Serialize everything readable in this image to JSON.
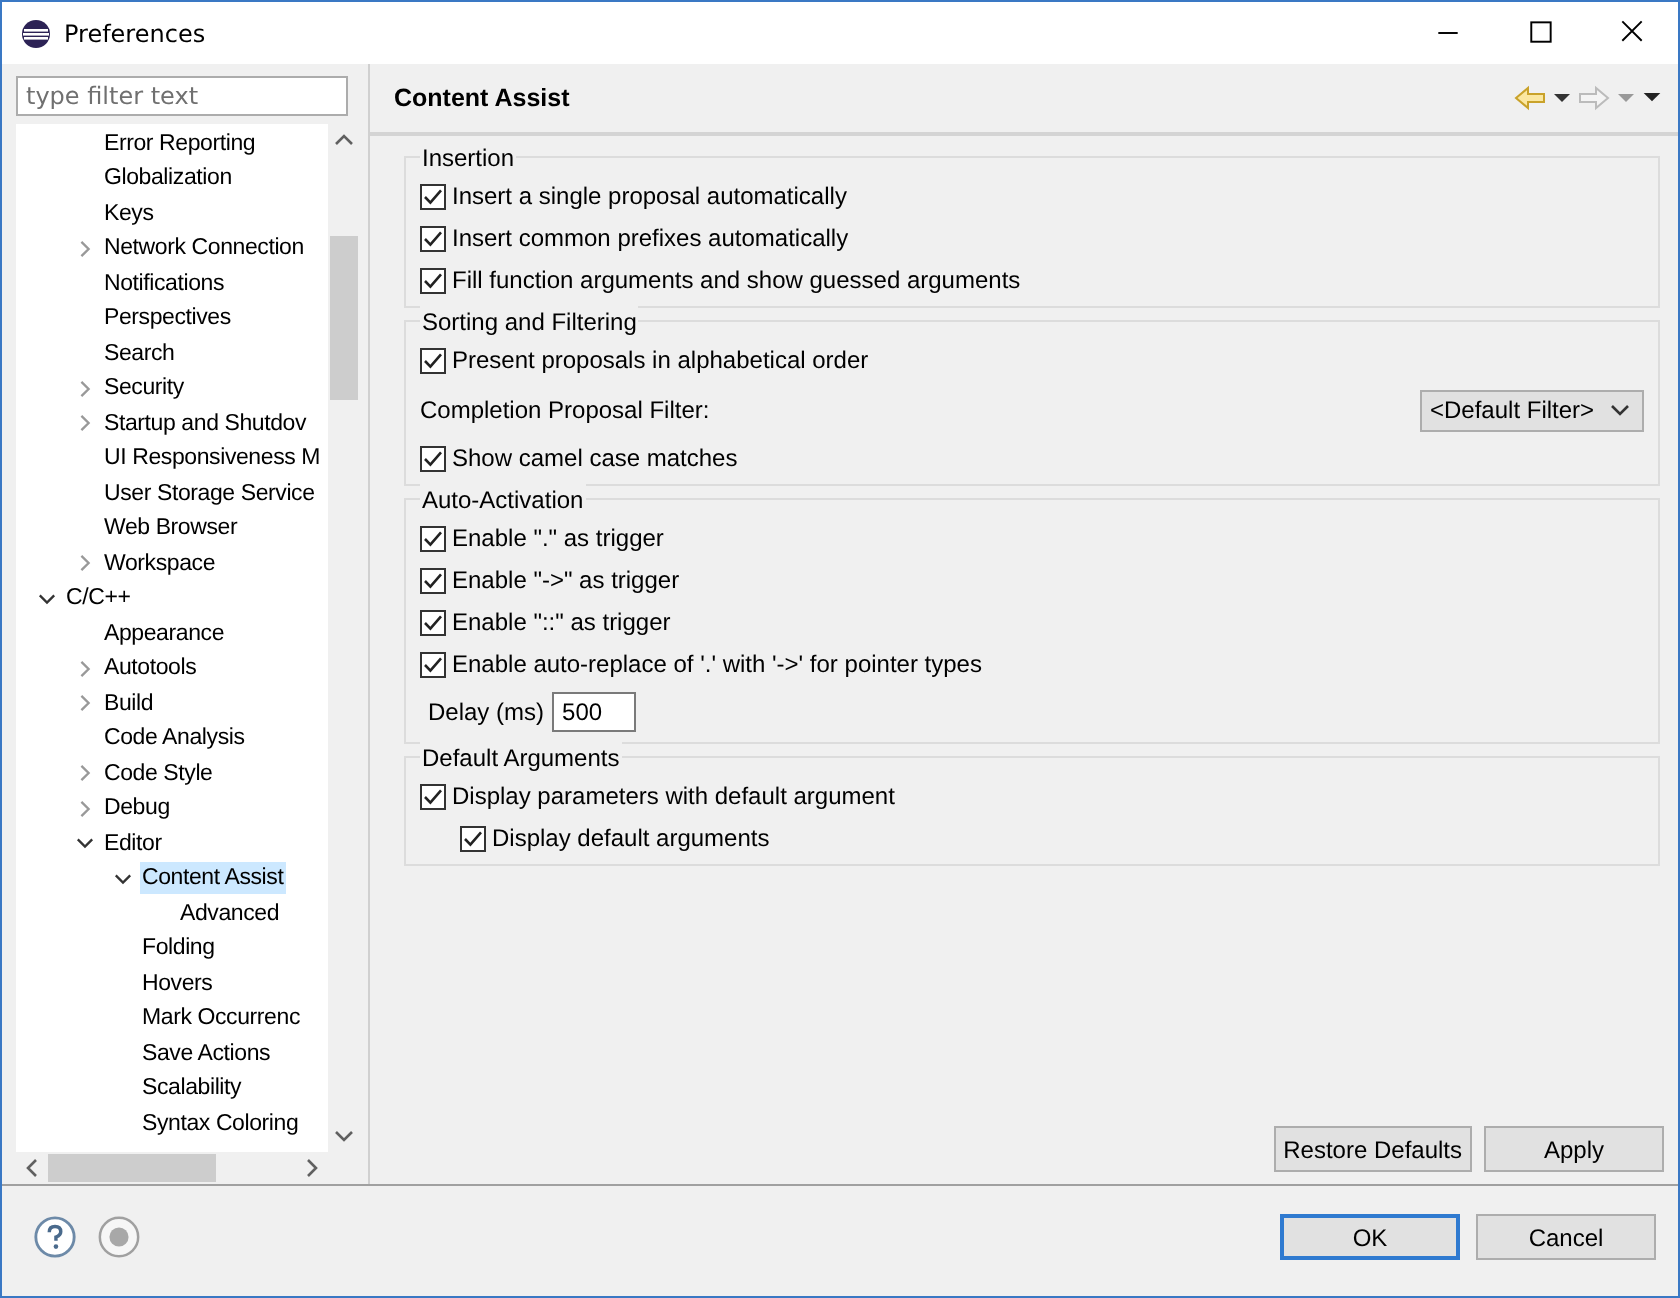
{
  "window": {
    "title": "Preferences"
  },
  "filter": {
    "placeholder": "type filter text"
  },
  "tree": [
    {
      "children": [
        {
          "label": "Error Reporting",
          "selected": false
        },
        {
          "label": "Globalization",
          "selected": false
        },
        {
          "label": "Keys",
          "selected": false
        },
        {
          "label": "Network Connection",
          "selected": false,
          "expanded": false
        },
        {
          "label": "Notifications",
          "selected": false
        },
        {
          "label": "Perspectives",
          "selected": false
        },
        {
          "label": "Search",
          "selected": false
        },
        {
          "label": "Security",
          "selected": false,
          "expanded": false
        },
        {
          "label": "Startup and Shutdov",
          "selected": false,
          "expanded": false
        },
        {
          "label": "UI Responsiveness M",
          "selected": false
        },
        {
          "label": "User Storage Service",
          "selected": false
        },
        {
          "label": "Web Browser",
          "selected": false
        },
        {
          "label": "Workspace",
          "selected": false,
          "expanded": false
        }
      ]
    },
    {
      "label": "C/C++",
      "selected": false,
      "expanded": true,
      "children": [
        {
          "label": "Appearance",
          "selected": false
        },
        {
          "label": "Autotools",
          "selected": false,
          "expanded": false
        },
        {
          "label": "Build",
          "selected": false,
          "expanded": false
        },
        {
          "label": "Code Analysis",
          "selected": false
        },
        {
          "label": "Code Style",
          "selected": false,
          "expanded": false
        },
        {
          "label": "Debug",
          "selected": false,
          "expanded": false
        },
        {
          "label": "Editor",
          "selected": false,
          "expanded": true,
          "children": [
            {
              "label": "Content Assist",
              "selected": true,
              "expanded": true,
              "children": [
                {
                  "label": "Advanced",
                  "selected": false
                }
              ]
            },
            {
              "label": "Folding",
              "selected": false
            },
            {
              "label": "Hovers",
              "selected": false
            },
            {
              "label": "Mark Occurrenc",
              "selected": false
            },
            {
              "label": "Save Actions",
              "selected": false
            },
            {
              "label": "Scalability",
              "selected": false
            },
            {
              "label": "Syntax Coloring",
              "selected": false
            }
          ]
        }
      ]
    }
  ],
  "page": {
    "title": "Content Assist",
    "groups": [
      {
        "title": "Insertion",
        "rows": [
          {
            "kind": "checkbox",
            "label": "Insert a single proposal automatically",
            "checked": true
          },
          {
            "kind": "checkbox",
            "label": "Insert common prefixes automatically",
            "checked": true
          },
          {
            "kind": "checkbox",
            "label": "Fill function arguments and show guessed arguments",
            "checked": true
          }
        ]
      },
      {
        "title": "Sorting and Filtering",
        "rows": [
          {
            "kind": "checkbox",
            "label": "Present proposals in alphabetical order",
            "checked": true
          },
          {
            "kind": "select",
            "label": "Completion Proposal Filter:",
            "value": "<Default Filter>"
          },
          {
            "kind": "checkbox",
            "label": "Show camel case matches",
            "checked": true
          }
        ]
      },
      {
        "title": "Auto-Activation",
        "rows": [
          {
            "kind": "checkbox",
            "label": "Enable \".\" as trigger",
            "checked": true
          },
          {
            "kind": "checkbox",
            "label": "Enable \"->\" as trigger",
            "checked": true
          },
          {
            "kind": "checkbox",
            "label": "Enable \"::\" as trigger",
            "checked": true
          },
          {
            "kind": "checkbox",
            "label": "Enable auto-replace of '.' with '->' for pointer types",
            "checked": true
          },
          {
            "kind": "number",
            "label": "Delay (ms)",
            "value": "500"
          }
        ]
      },
      {
        "title": "Default Arguments",
        "rows": [
          {
            "kind": "checkbox",
            "label": "Display parameters with default argument",
            "checked": true,
            "children": [
              {
                "kind": "checkbox",
                "label": "Display default arguments",
                "checked": true
              }
            ]
          }
        ]
      }
    ],
    "page_buttons": [
      "Restore Defaults",
      "Apply"
    ]
  },
  "dialog_buttons": [
    {
      "label": "OK",
      "default": true
    },
    {
      "label": "Cancel",
      "default": false
    }
  ]
}
